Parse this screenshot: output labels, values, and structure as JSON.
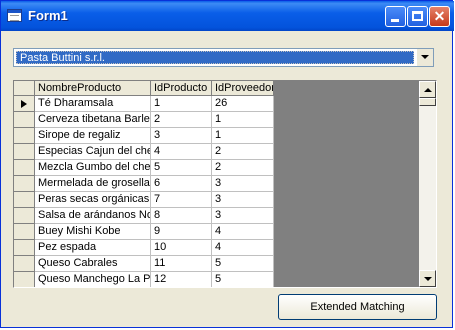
{
  "window": {
    "title": "Form1",
    "icons": {
      "app": "form-window-icon",
      "minimize": "minimize-icon",
      "maximize": "maximize-icon",
      "close": "close-icon"
    }
  },
  "supplier_combo": {
    "selected": "Pasta Buttini s.r.l.",
    "dropdown_icon": "chevron-down-icon"
  },
  "grid": {
    "columns": [
      "NombreProducto",
      "IdProducto",
      "IdProveedor"
    ],
    "current_row_indicator": "row-pointer-icon",
    "rows": [
      [
        "Té Dharamsala",
        "1",
        "26"
      ],
      [
        "Cerveza tibetana Barley",
        "2",
        "1"
      ],
      [
        "Sirope de regaliz",
        "3",
        "1"
      ],
      [
        "Especias Cajun del chef",
        "4",
        "2"
      ],
      [
        "Mezcla Gumbo del chef",
        "5",
        "2"
      ],
      [
        "Mermelada de grosellas",
        "6",
        "3"
      ],
      [
        "Peras secas orgánicas d",
        "7",
        "3"
      ],
      [
        "Salsa de arándanos Nor",
        "8",
        "3"
      ],
      [
        "Buey Mishi Kobe",
        "9",
        "4"
      ],
      [
        "Pez espada",
        "10",
        "4"
      ],
      [
        "Queso Cabrales",
        "11",
        "5"
      ],
      [
        "Queso Manchego La Pa",
        "12",
        "5"
      ]
    ]
  },
  "button": {
    "label": "Extended Matching"
  },
  "colors": {
    "title_bar": "#0a5ee8",
    "selection": "#316ac5",
    "face": "#ece9d8"
  }
}
